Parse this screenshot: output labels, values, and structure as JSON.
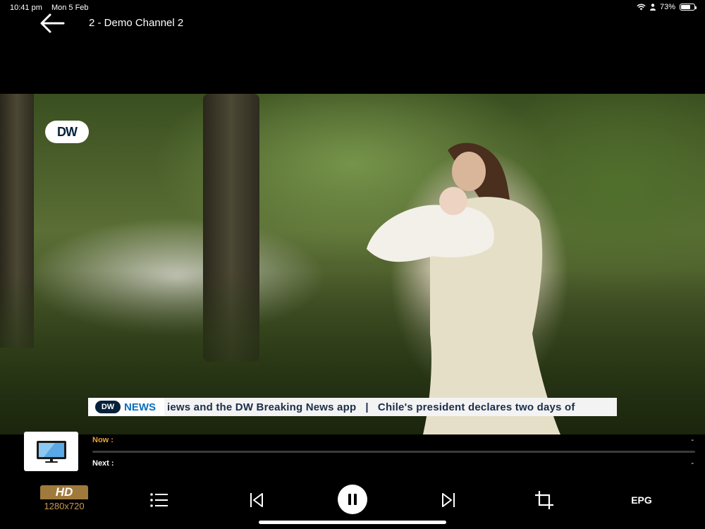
{
  "status_bar": {
    "time": "10:41 pm",
    "date": "Mon 5 Feb",
    "battery": "73%",
    "battery_level": 0.73
  },
  "header": {
    "back_icon": "arrow-left-icon",
    "channel_title": "2 - Demo Channel 2"
  },
  "video": {
    "logo": "DW",
    "ticker": {
      "brand_logo": "DW",
      "brand_name": "NEWS",
      "text": "iews and the DW Breaking News app   |   Chile's president declares two days of"
    }
  },
  "info_bar": {
    "thumbnail_icon": "tv-icon",
    "now_label": "Now :",
    "now_value": "-",
    "next_label": "Next :",
    "next_value": "-",
    "now_color": "#e8a23a"
  },
  "controls": {
    "quality_badge": "HD",
    "resolution": "1280x720",
    "list_icon": "list-icon",
    "previous_icon": "skip-previous-icon",
    "pause_icon": "pause-icon",
    "next_icon": "skip-next-icon",
    "crop_icon": "crop-icon",
    "epg_label": "EPG"
  }
}
